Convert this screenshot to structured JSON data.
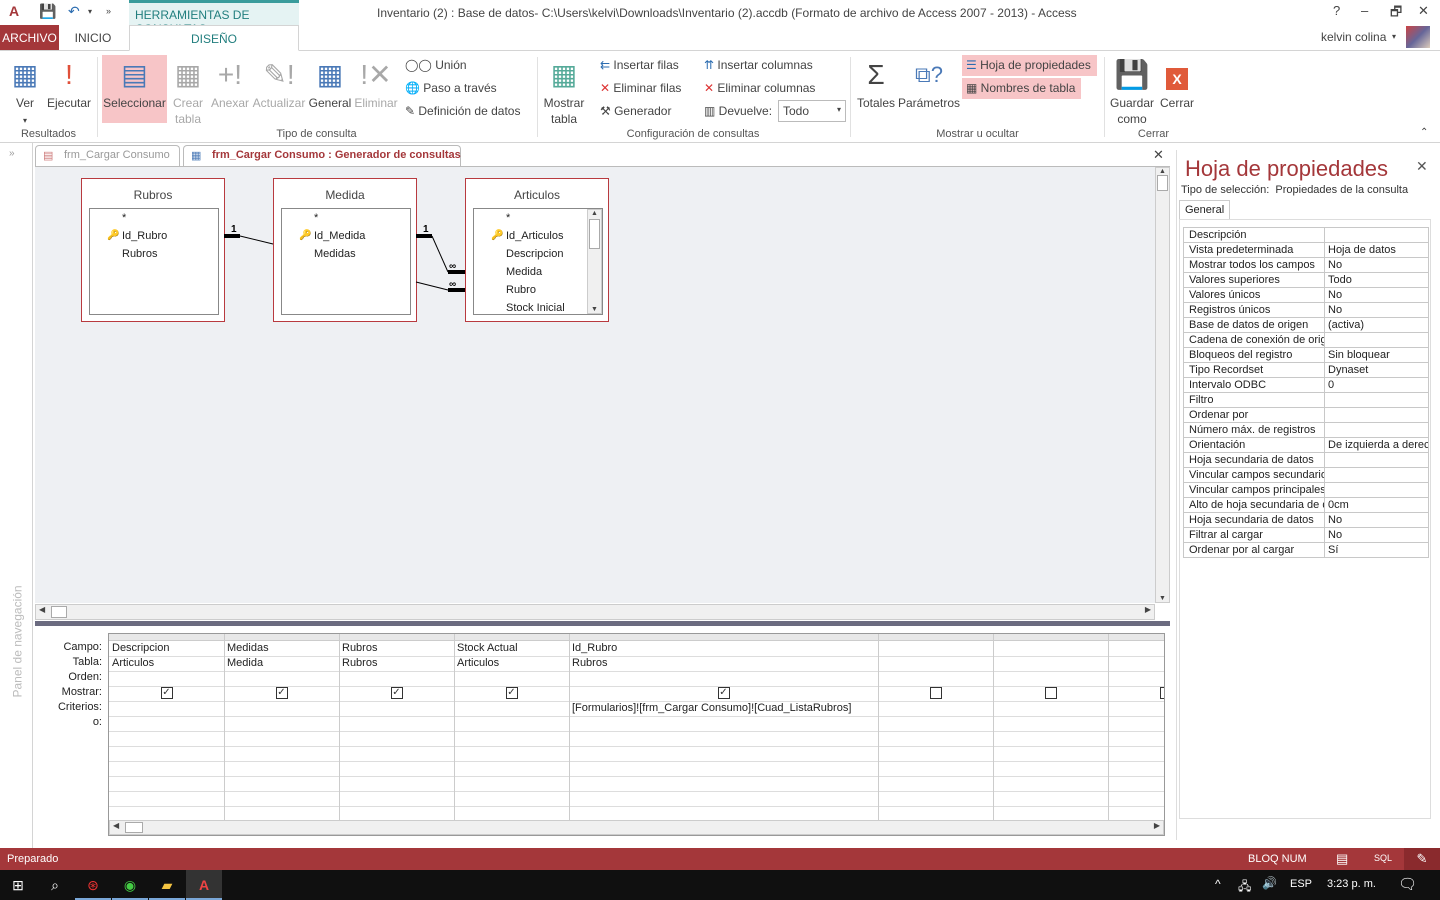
{
  "window": {
    "title": "Inventario (2) : Base de datos- C:\\Users\\kelvi\\Downloads\\Inventario (2).accdb (Formato de archivo de Access 2007 - 2013) - Access",
    "context_tab": "HERRAMIENTAS DE CONSULTAS",
    "user": "kelvin colina",
    "help": "?",
    "minimize": "–",
    "restore": "🗗",
    "close": "✕"
  },
  "tabs": [
    {
      "label": "ARCHIVO"
    },
    {
      "label": "INICIO"
    },
    {
      "label": "DISEÑO"
    }
  ],
  "ribbon": {
    "resultados": {
      "label": "Resultados",
      "ver": "Ver",
      "ejecutar": "Ejecutar"
    },
    "tipo": {
      "label": "Tipo de consulta",
      "seleccionar": "Seleccionar",
      "crear_tabla": "Crear tabla",
      "anexar": "Anexar",
      "actualizar": "Actualizar",
      "general": "General",
      "eliminar": "Eliminar",
      "union": "Unión",
      "paso": "Paso a través",
      "definicion": "Definición de datos"
    },
    "config": {
      "label": "Configuración de consultas",
      "mostrar_tabla": "Mostrar tabla",
      "insertar_filas": "Insertar filas",
      "eliminar_filas": "Eliminar filas",
      "generador": "Generador",
      "insertar_columnas": "Insertar columnas",
      "eliminar_columnas": "Eliminar columnas",
      "devuelve": "Devuelve:",
      "devuelve_value": "Todo"
    },
    "mostrar": {
      "label": "Mostrar u ocultar",
      "totales": "Totales",
      "parametros": "Parámetros",
      "hoja_prop": "Hoja de propiedades",
      "nombres_tabla": "Nombres de tabla"
    },
    "cerrar": {
      "label": "Cerrar",
      "guardar": "Guardar como",
      "cerrar": "Cerrar"
    }
  },
  "nav_pane": {
    "label": "Panel de navegación"
  },
  "doc_tabs": [
    {
      "label": "frm_Cargar Consumo",
      "active": false
    },
    {
      "label": "frm_Cargar Consumo : Generador de consultas",
      "active": true
    }
  ],
  "tables": [
    {
      "name": "Rubros",
      "fields": [
        "*",
        "Id_Rubro",
        "Rubros"
      ],
      "key": "Id_Rubro"
    },
    {
      "name": "Medida",
      "fields": [
        "*",
        "Id_Medida",
        "Medidas"
      ],
      "key": "Id_Medida"
    },
    {
      "name": "Articulos",
      "fields": [
        "*",
        "Id_Articulos",
        "Descripcion",
        "Medida",
        "Rubro",
        "Stock Inicial"
      ],
      "key": "Id_Articulos"
    }
  ],
  "relations": {
    "one": "1",
    "many": "∞"
  },
  "grid": {
    "row_labels": [
      "Campo:",
      "Tabla:",
      "Orden:",
      "Mostrar:",
      "Criterios:",
      "o:"
    ],
    "columns": [
      {
        "campo": "Descripcion",
        "tabla": "Articulos",
        "mostrar": true,
        "criterios": ""
      },
      {
        "campo": "Medidas",
        "tabla": "Medida",
        "mostrar": true,
        "criterios": ""
      },
      {
        "campo": "Rubros",
        "tabla": "Rubros",
        "mostrar": true,
        "criterios": ""
      },
      {
        "campo": "Stock Actual",
        "tabla": "Articulos",
        "mostrar": true,
        "criterios": ""
      },
      {
        "campo": "Id_Rubro",
        "tabla": "Rubros",
        "mostrar": true,
        "criterios": "[Formularios]![frm_Cargar Consumo]![Cuad_ListaRubros]"
      },
      {
        "campo": "",
        "tabla": "",
        "mostrar": false,
        "criterios": ""
      },
      {
        "campo": "",
        "tabla": "",
        "mostrar": false,
        "criterios": ""
      },
      {
        "campo": "",
        "tabla": "",
        "mostrar": false,
        "criterios": ""
      }
    ]
  },
  "property_sheet": {
    "title": "Hoja de propiedades",
    "selection_label": "Tipo de selección:",
    "selection_value": "Propiedades de la consulta",
    "tab": "General",
    "rows": [
      {
        "name": "Descripción",
        "value": ""
      },
      {
        "name": "Vista predeterminada",
        "value": "Hoja de datos"
      },
      {
        "name": "Mostrar todos los campos",
        "value": "No"
      },
      {
        "name": "Valores superiores",
        "value": "Todo"
      },
      {
        "name": "Valores únicos",
        "value": "No"
      },
      {
        "name": "Registros únicos",
        "value": "No"
      },
      {
        "name": "Base de datos de origen",
        "value": "(activa)"
      },
      {
        "name": "Cadena de conexión de origen",
        "value": ""
      },
      {
        "name": "Bloqueos del registro",
        "value": "Sin bloquear"
      },
      {
        "name": "Tipo Recordset",
        "value": "Dynaset"
      },
      {
        "name": "Intervalo ODBC",
        "value": "0"
      },
      {
        "name": "Filtro",
        "value": ""
      },
      {
        "name": "Ordenar por",
        "value": ""
      },
      {
        "name": "Número máx. de registros",
        "value": ""
      },
      {
        "name": "Orientación",
        "value": "De izquierda a derecha"
      },
      {
        "name": "Hoja secundaria de datos",
        "value": ""
      },
      {
        "name": "Vincular campos secundarios",
        "value": ""
      },
      {
        "name": "Vincular campos principales",
        "value": ""
      },
      {
        "name": "Alto de hoja secundaria de datos",
        "value": "0cm"
      },
      {
        "name": "Hoja secundaria de datos",
        "value": "No"
      },
      {
        "name": "Filtrar al cargar",
        "value": "No"
      },
      {
        "name": "Ordenar por al cargar",
        "value": "Sí"
      }
    ]
  },
  "status": {
    "text": "Preparado",
    "bloq_num": "BLOQ NUM",
    "sql": "SQL"
  },
  "taskbar": {
    "lang": "ESP",
    "time": "3:23 p. m."
  },
  "colors": {
    "accent": "#a4373a",
    "highlight": "#f7c5c7",
    "context": "#217e7e"
  }
}
